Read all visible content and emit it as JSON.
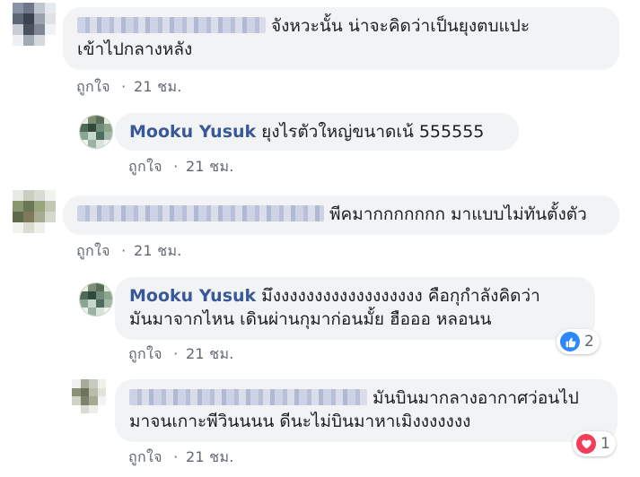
{
  "comments": [
    {
      "name_redacted": true,
      "text_line1": "จังหวะนั้น น่าจะคิดว่าเป็นยุงตบแปะ",
      "text_line2": "เข้าไปกลางหลัง",
      "like_label": "ถูกใจ",
      "separator": "·",
      "time": "21 ชม."
    },
    {
      "name": "Mooku Yusuk",
      "text_line1": "ยุงไรตัวใหญ่ขนาดเน้ 555555",
      "like_label": "ถูกใจ",
      "separator": "·",
      "time": "21 ชม."
    },
    {
      "name_redacted": true,
      "text_line1": "พีคมากกกกกกก มาแบบไม่ทันตั้งตัว",
      "like_label": "ถูกใจ",
      "separator": "·",
      "time": "21 ชม."
    },
    {
      "name": "Mooku Yusuk",
      "text_line1": "มึงงงงงงงงงงงงงงงงงง คือกุกำลังคิดว่า",
      "text_line2": "มันมาจากไหน เดินผ่านกุมาก่อนมั้ย ฮือออ หลอนน",
      "like_label": "ถูกใจ",
      "separator": "·",
      "time": "21 ชม.",
      "reaction": {
        "type": "like",
        "count": "2",
        "color": "#2d88ff"
      }
    },
    {
      "name_redacted": true,
      "text_line1": "มันบินมากลางอากาศว่อนไป",
      "text_line2": "มาจนเกาะพีวินนนน ดีนะไม่บินมาหาเมิงงงงงงง",
      "like_label": "ถูกใจ",
      "separator": "·",
      "time": "21 ชม.",
      "reaction": {
        "type": "love",
        "count": "1",
        "color": "#f33e58"
      }
    }
  ],
  "colors": {
    "bubble": "#f2f3f5",
    "name": "#385898",
    "meta": "#606770"
  }
}
